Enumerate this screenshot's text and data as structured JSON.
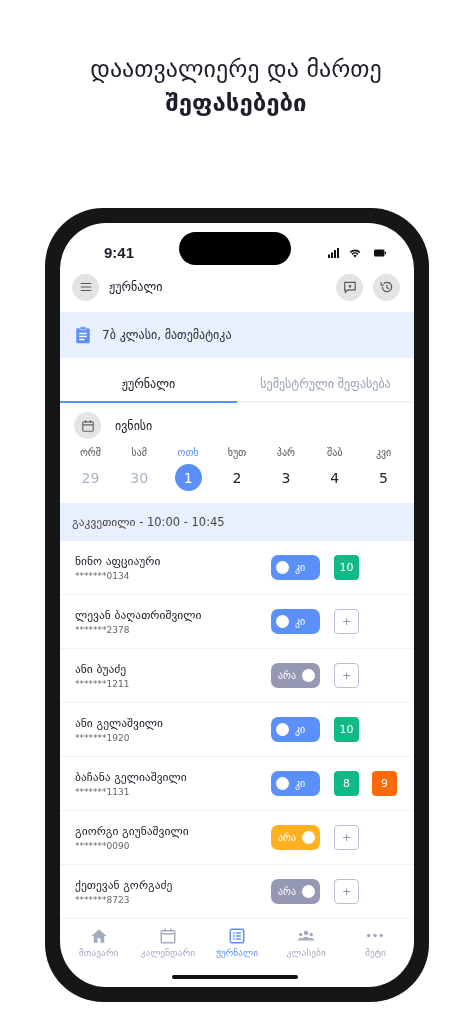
{
  "headline": {
    "line_1": "დაათვალიერე და მართე",
    "line_2": "შეფასებები"
  },
  "status_bar": {
    "time": "9:41"
  },
  "header": {
    "title": "ჟურნალი"
  },
  "class_banner": {
    "text": "7ბ კლასი, მათემატიკა"
  },
  "tabs": [
    {
      "label": "ჟურნალი",
      "selected": true
    },
    {
      "label": "სემესტრული შეფასება",
      "selected": false
    }
  ],
  "month": {
    "label": "ივნისი"
  },
  "days": [
    {
      "weekday": "ორშ",
      "date": "29",
      "selected": false,
      "muted": true
    },
    {
      "weekday": "სამ",
      "date": "30",
      "selected": false,
      "muted": true
    },
    {
      "weekday": "ოთხ",
      "date": "1",
      "selected": true,
      "muted": false
    },
    {
      "weekday": "ხუთ",
      "date": "2",
      "selected": false,
      "muted": false
    },
    {
      "weekday": "პარ",
      "date": "3",
      "selected": false,
      "muted": false
    },
    {
      "weekday": "შაბ",
      "date": "4",
      "selected": false,
      "muted": false
    },
    {
      "weekday": "კვი",
      "date": "5",
      "selected": false,
      "muted": false
    }
  ],
  "lesson": {
    "text": "გაკვეთილი - 10:00 - 10:45"
  },
  "students": [
    {
      "name": "ნინო აფციაური",
      "id": "*******0134",
      "toggle": {
        "label": "კი",
        "kind": "yes",
        "color": "#5b8ff9"
      },
      "grades": [
        {
          "value": "10",
          "color": "#12b886"
        }
      ]
    },
    {
      "name": "ლევან ბაღათრიშვილი",
      "id": "*******2378",
      "toggle": {
        "label": "კი",
        "kind": "yes",
        "color": "#5b8ff9"
      },
      "add_button": {
        "label": "+"
      }
    },
    {
      "name": "ანი ბუაძე",
      "id": "*******1211",
      "toggle": {
        "label": "არა",
        "kind": "no",
        "color": "#9598b2"
      },
      "add_button": {
        "label": "+"
      }
    },
    {
      "name": "ანი გელაშვილი",
      "id": "*******1920",
      "toggle": {
        "label": "კი",
        "kind": "yes",
        "color": "#5b8ff9"
      },
      "grades": [
        {
          "value": "10",
          "color": "#12b886"
        }
      ]
    },
    {
      "name": "ბაჩანა გელიაშვილი",
      "id": "*******1131",
      "toggle": {
        "label": "კი",
        "kind": "yes",
        "color": "#5b8ff9"
      },
      "grades": [
        {
          "value": "8",
          "color": "#12b886"
        },
        {
          "value": "9",
          "color": "#fd6a0a"
        }
      ]
    },
    {
      "name": "გიორგი გიუნაშვილი",
      "id": "*******0090",
      "toggle": {
        "label": "არა",
        "kind": "no",
        "color": "#ffb11f"
      },
      "add_button": {
        "label": "+"
      }
    },
    {
      "name": "ქეთევან გორგაძე",
      "id": "*******8723",
      "toggle": {
        "label": "არა",
        "kind": "no",
        "color": "#9598b2"
      },
      "add_button": {
        "label": "+"
      }
    }
  ],
  "bottom_nav": [
    {
      "kind": "home",
      "label": "მთავარი",
      "selected": false
    },
    {
      "kind": "calendar",
      "label": "კალენდარი",
      "selected": false
    },
    {
      "kind": "journal",
      "label": "ჟურნალი",
      "selected": true
    },
    {
      "kind": "classes",
      "label": "კლასები",
      "selected": false
    },
    {
      "kind": "more",
      "label": "მეტი",
      "selected": false
    }
  ]
}
